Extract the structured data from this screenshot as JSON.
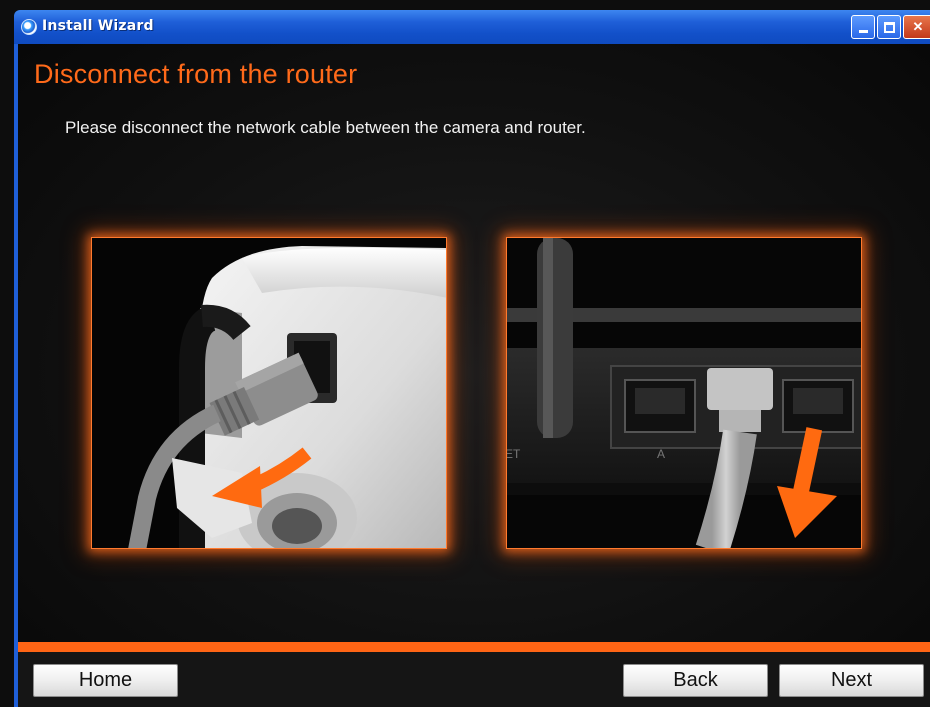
{
  "window": {
    "title": "Install Wizard",
    "title_icon": "app-globe-icon",
    "controls": [
      "minimize-icon",
      "maximize-icon",
      "close-icon"
    ]
  },
  "page": {
    "title": "Disconnect from the router",
    "instruction": "Please disconnect the network cable between the camera and router."
  },
  "images": {
    "left": {
      "icon": "camera-cable-photo"
    },
    "right": {
      "icon": "router-port-photo"
    }
  },
  "buttons": {
    "home": "Home",
    "back": "Back",
    "next": "Next"
  },
  "colors": {
    "accent": "#ff6515",
    "title_text": "#ff6a1a",
    "titlebar": "#1f5fd8",
    "background": "#0d0d0d"
  }
}
